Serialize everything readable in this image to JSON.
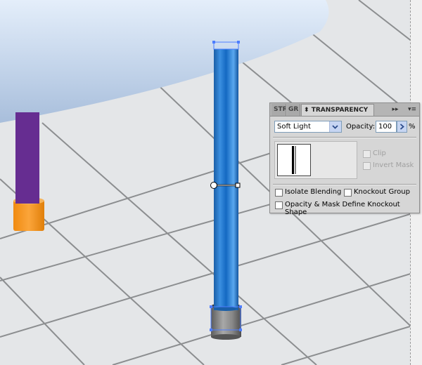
{
  "panel": {
    "tabs": [
      {
        "label": "STR"
      },
      {
        "label": "GR"
      },
      {
        "label": "TRANSPARENCY"
      }
    ],
    "tab_active_prefix": "⬍",
    "expand_icon": "▸▸",
    "menu_icon": "▾≡",
    "blend_mode": "Soft Light",
    "opacity_label": "Opacity:",
    "opacity_value": "100",
    "percent": "%",
    "clip_label": "Clip",
    "invert_mask_label": "Invert Mask",
    "isolate_blending_label": "Isolate Blending",
    "knockout_group_label": "Knockout Group",
    "opacity_mask_label": "Opacity & Mask Define Knockout Shape"
  },
  "colors": {
    "floor": "#e4e6e8",
    "floor_lines": "#8c8e90",
    "table_top": "#bccfe6",
    "leg_purple": "#662d91",
    "foot_orange": "#f7941e",
    "pole_blue": "#1a70c6",
    "cap_gray": "#8a8a8a",
    "selection": "#4d7dff",
    "panel_bg": "#d6d6d6"
  }
}
